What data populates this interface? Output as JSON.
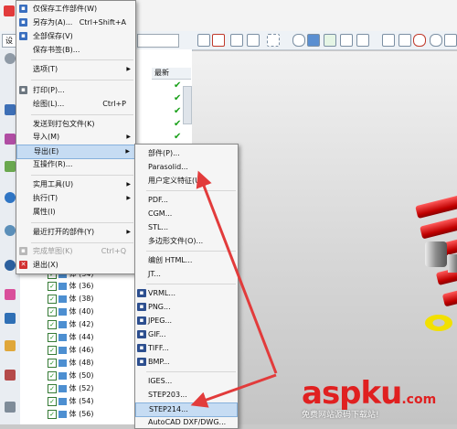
{
  "file_menu": {
    "items": [
      {
        "label": "仅保存工作部件(W)",
        "shortcut": "",
        "has_submenu": false
      },
      {
        "label": "另存为(A)...",
        "shortcut": "Ctrl+Shift+A",
        "has_submenu": false
      },
      {
        "label": "全部保存(V)",
        "shortcut": "",
        "has_submenu": false
      },
      {
        "label": "保存书签(B)...",
        "shortcut": "",
        "has_submenu": false
      },
      {
        "label": "选项(T)",
        "shortcut": "",
        "has_submenu": true
      },
      {
        "label": "打印(P)...",
        "shortcut": "",
        "has_submenu": false
      },
      {
        "label": "绘图(L)...",
        "shortcut": "Ctrl+P",
        "has_submenu": false
      },
      {
        "label": "发送到打包文件(K)",
        "shortcut": "",
        "has_submenu": false
      },
      {
        "label": "导入(M)",
        "shortcut": "",
        "has_submenu": true
      },
      {
        "label": "导出(E)",
        "shortcut": "",
        "has_submenu": true
      },
      {
        "label": "互操作(R)...",
        "shortcut": "",
        "has_submenu": false
      },
      {
        "label": "实用工具(U)",
        "shortcut": "",
        "has_submenu": true
      },
      {
        "label": "执行(T)",
        "shortcut": "",
        "has_submenu": true
      },
      {
        "label": "属性(I)",
        "shortcut": "",
        "has_submenu": false
      },
      {
        "label": "最近打开的部件(Y)",
        "shortcut": "",
        "has_submenu": true
      },
      {
        "label": "完成草图(K)",
        "shortcut": "Ctrl+Q",
        "has_submenu": false
      },
      {
        "label": "退出(X)",
        "shortcut": "",
        "has_submenu": false
      }
    ]
  },
  "export_submenu": {
    "items": [
      {
        "label": "部件(P)..."
      },
      {
        "label": "Parasolid..."
      },
      {
        "label": "用户定义特征(U)..."
      },
      {
        "label": "PDF..."
      },
      {
        "label": "CGM..."
      },
      {
        "label": "STL..."
      },
      {
        "label": "多边形文件(O)..."
      },
      {
        "label": "编创 HTML..."
      },
      {
        "label": "JT..."
      },
      {
        "label": "VRML..."
      },
      {
        "label": "PNG..."
      },
      {
        "label": "JPEG..."
      },
      {
        "label": "GIF..."
      },
      {
        "label": "TIFF..."
      },
      {
        "label": "BMP..."
      },
      {
        "label": "IGES..."
      },
      {
        "label": "STEP203..."
      },
      {
        "label": "STEP214..."
      },
      {
        "label": "AutoCAD DXF/DWG..."
      }
    ]
  },
  "tree": {
    "column_latest": "最新",
    "rows": [
      "体 (34)",
      "体 (36)",
      "体 (38)",
      "体 (40)",
      "体 (42)",
      "体 (44)",
      "体 (46)",
      "体 (48)",
      "体 (50)",
      "体 (52)",
      "体 (54)",
      "体 (56)"
    ]
  },
  "toolbar": {
    "left_combo": "设"
  },
  "watermark": {
    "brand": "aspku",
    "suffix": ".com",
    "subtitle": "免费网站源码下载站!"
  },
  "colors": {
    "highlight": "#c6dcf3",
    "arrow": "#e23b3b",
    "pipe": "#d40000"
  }
}
